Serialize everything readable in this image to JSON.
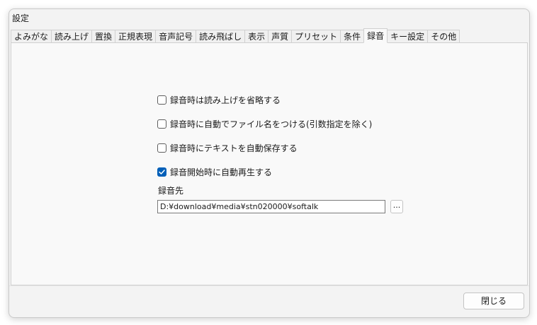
{
  "window": {
    "title": "設定"
  },
  "tabs": [
    {
      "label": "よみがな",
      "active": false
    },
    {
      "label": "読み上げ",
      "active": false
    },
    {
      "label": "置換",
      "active": false
    },
    {
      "label": "正規表現",
      "active": false
    },
    {
      "label": "音声記号",
      "active": false
    },
    {
      "label": "読み飛ばし",
      "active": false
    },
    {
      "label": "表示",
      "active": false
    },
    {
      "label": "声質",
      "active": false
    },
    {
      "label": "プリセット",
      "active": false
    },
    {
      "label": "条件",
      "active": false
    },
    {
      "label": "録音",
      "active": true
    },
    {
      "label": "キー設定",
      "active": false
    },
    {
      "label": "その他",
      "active": false
    }
  ],
  "recording": {
    "options": [
      {
        "label": "録音時は読み上げを省略する",
        "checked": false
      },
      {
        "label": "録音時に自動でファイル名をつける(引数指定を除く)",
        "checked": false
      },
      {
        "label": "録音時にテキストを自動保存する",
        "checked": false
      },
      {
        "label": "録音開始時に自動再生する",
        "checked": true
      }
    ],
    "folder_label": "録音先",
    "folder_path": "D:¥download¥media¥stn020000¥softalk",
    "browse_label": "..."
  },
  "footer": {
    "close_label": "閉じる"
  },
  "colors": {
    "accent": "#005fb8",
    "panel": "#f9f9f9",
    "window": "#f3f3f3"
  }
}
